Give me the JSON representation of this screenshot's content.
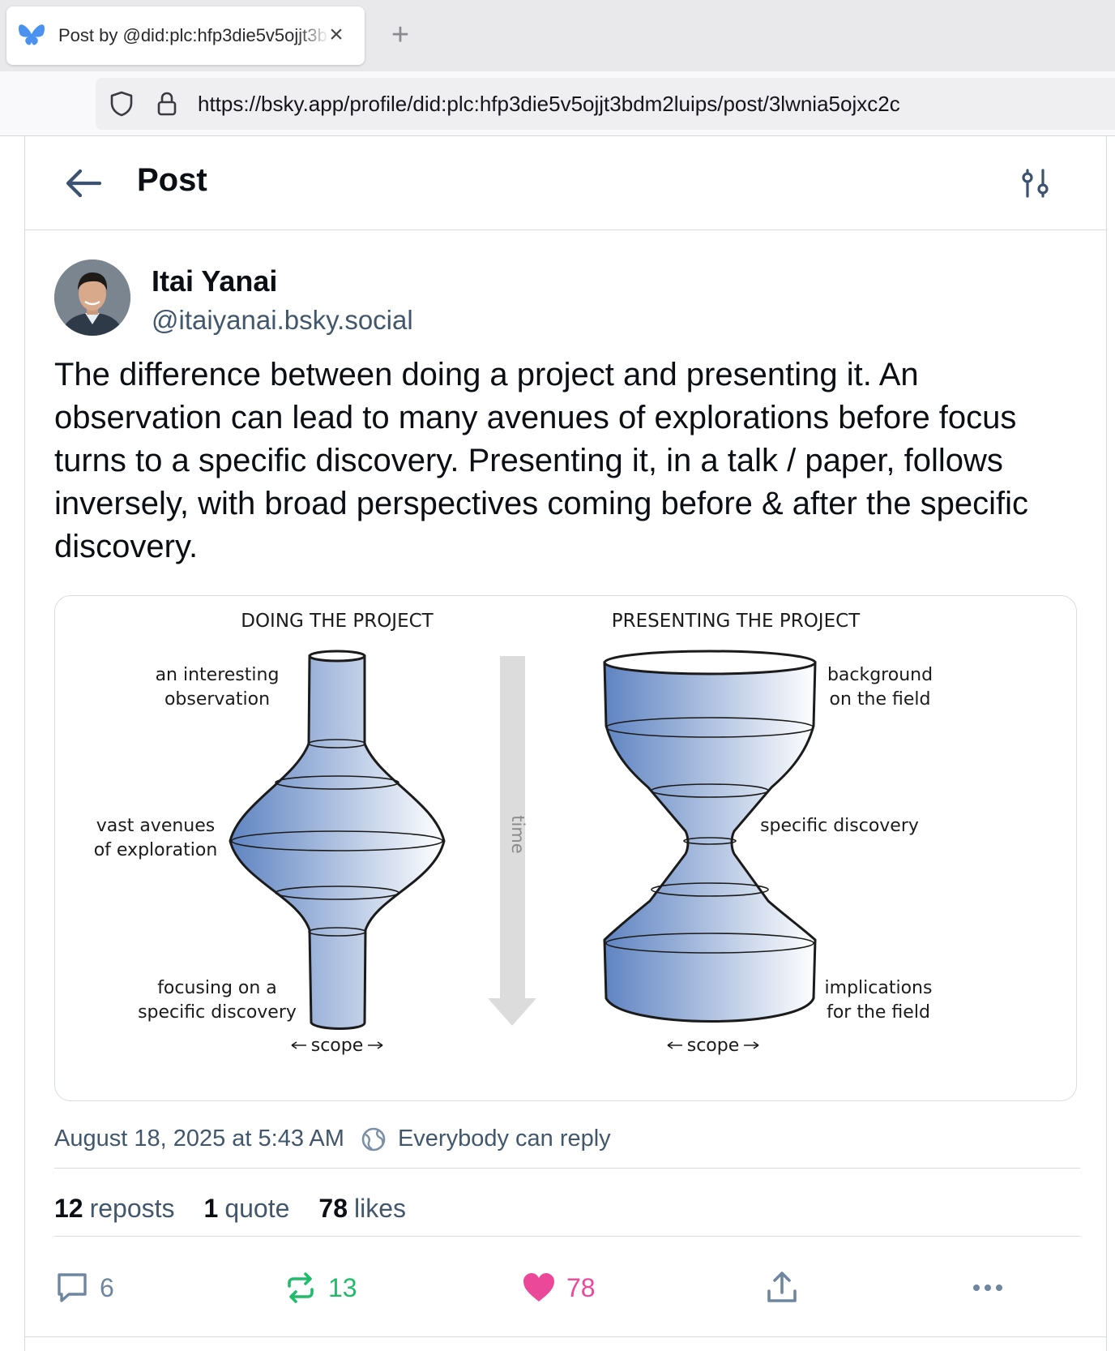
{
  "browser": {
    "tab_title": "Post by @did:plc:hfp3die5v5ojjt3bdm2luips",
    "close_symbol": "×",
    "new_tab_symbol": "+",
    "url": "https://bsky.app/profile/did:plc:hfp3die5v5ojjt3bdm2luips/post/3lwnia5ojxc2c"
  },
  "header": {
    "title": "Post",
    "back_icon": "arrow-left-icon",
    "settings_icon": "sliders-icon"
  },
  "author": {
    "name": "Itai Yanai",
    "handle": "@itaiyanai.bsky.social"
  },
  "post": {
    "text": "The difference between doing a project and presenting it. An observation can lead to many avenues of explorations before focus turns to a specific discovery. Presenting it, in a talk / paper, follows inversely, with broad perspectives coming before & after the specific discovery."
  },
  "figure": {
    "left_title": "DOING THE PROJECT",
    "right_title": "PRESENTING THE PROJECT",
    "time_label": "time",
    "left_labels": {
      "top_1": "an interesting",
      "top_2": "observation",
      "mid_1": "vast avenues",
      "mid_2": "of exploration",
      "bottom_1": "focusing on a",
      "bottom_2": "specific discovery",
      "scope": "scope"
    },
    "right_labels": {
      "top_1": "background",
      "top_2": "on the field",
      "mid": "specific discovery",
      "bottom_1": "implications",
      "bottom_2": "for the field",
      "scope": "scope"
    },
    "shape_color": "#5f84c2"
  },
  "meta": {
    "date": "August 18, 2025 at 5:43 AM",
    "reply_setting": "Everybody can reply"
  },
  "stats": {
    "reposts_count": "12",
    "reposts_label": "reposts",
    "quotes_count": "1",
    "quotes_label": "quote",
    "likes_count": "78",
    "likes_label": "likes"
  },
  "actions": {
    "reply_count": "6",
    "repost_count": "13",
    "like_count": "78",
    "repost_color": "#20bc6b",
    "like_color": "#ec4899"
  }
}
